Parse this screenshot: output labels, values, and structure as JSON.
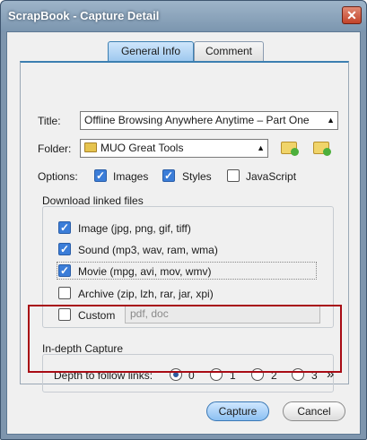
{
  "window": {
    "title": "ScrapBook - Capture Detail",
    "close_symbol": "✕"
  },
  "tabs": [
    {
      "label": "General Info",
      "selected": true
    },
    {
      "label": "Comment",
      "selected": false
    }
  ],
  "form": {
    "title_label": "Title:",
    "title_value": "Offline Browsing Anywhere Anytime – Part One",
    "folder_label": "Folder:",
    "folder_value": "MUO Great Tools",
    "options_label": "Options:",
    "options": [
      {
        "label": "Images",
        "checked": true
      },
      {
        "label": "Styles",
        "checked": true
      },
      {
        "label": "JavaScript",
        "checked": false
      }
    ]
  },
  "download": {
    "title": "Download linked files",
    "items": [
      {
        "label": "Image (jpg, png, gif, tiff)",
        "checked": true
      },
      {
        "label": "Sound (mp3, wav, ram, wma)",
        "checked": true
      },
      {
        "label": "Movie (mpg, avi, mov, wmv)",
        "checked": true
      },
      {
        "label": "Archive (zip, lzh, rar, jar, xpi)",
        "checked": false
      },
      {
        "label": "Custom",
        "checked": false
      }
    ],
    "custom_placeholder": "pdf, doc"
  },
  "depth": {
    "title": "In-depth Capture",
    "label": "Depth to follow links:",
    "options": [
      "0",
      "1",
      "2",
      "3"
    ],
    "selected": "0",
    "more": "»"
  },
  "buttons": {
    "capture": "Capture",
    "cancel": "Cancel"
  },
  "colors": {
    "highlight": "#a80b14",
    "accent": "#3c7fb1"
  },
  "icons": [
    "folder-icon",
    "new-folder-icon",
    "open-folder-icon",
    "close-icon"
  ]
}
